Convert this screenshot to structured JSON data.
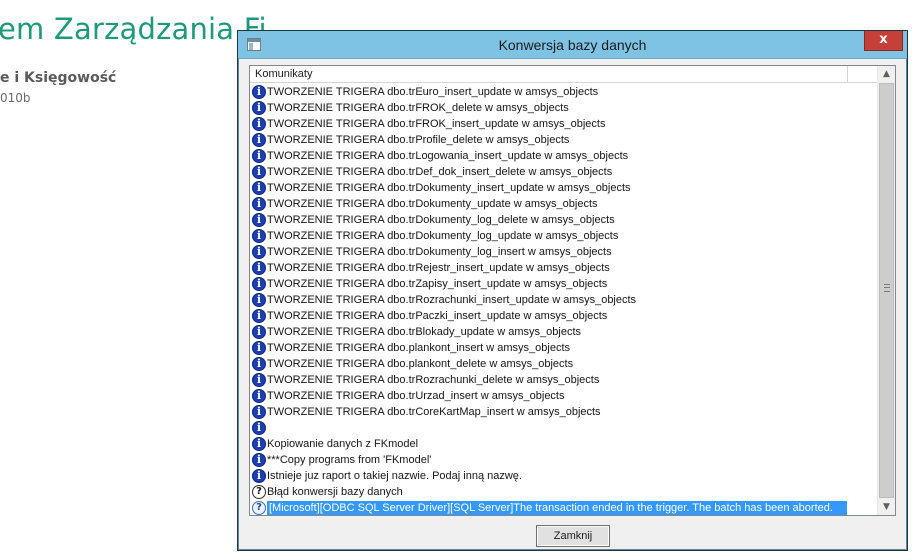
{
  "background": {
    "title": "em Zarządzania Fi",
    "subtitle": "e i Księgowość",
    "version": "010b",
    "accent_color": "#1e9a7a"
  },
  "dialog": {
    "title": "Konwersja bazy danych",
    "close_label": "x",
    "column_header": "Komunikaty",
    "close_button_label": "Zamknij",
    "messages": [
      {
        "icon": "info-icon",
        "text": "TWORZENIE TRIGERA dbo.trEuro_insert_update w amsys_objects"
      },
      {
        "icon": "info-icon",
        "text": "TWORZENIE TRIGERA dbo.trFROK_delete w amsys_objects"
      },
      {
        "icon": "info-icon",
        "text": "TWORZENIE TRIGERA dbo.trFROK_insert_update w amsys_objects"
      },
      {
        "icon": "info-icon",
        "text": "TWORZENIE TRIGERA dbo.trProfile_delete w amsys_objects"
      },
      {
        "icon": "info-icon",
        "text": "TWORZENIE TRIGERA dbo.trLogowania_insert_update w amsys_objects"
      },
      {
        "icon": "info-icon",
        "text": "TWORZENIE TRIGERA dbo.trDef_dok_insert_delete w amsys_objects"
      },
      {
        "icon": "info-icon",
        "text": "TWORZENIE TRIGERA dbo.trDokumenty_insert_update w amsys_objects"
      },
      {
        "icon": "info-icon",
        "text": "TWORZENIE TRIGERA dbo.trDokumenty_update w amsys_objects"
      },
      {
        "icon": "info-icon",
        "text": "TWORZENIE TRIGERA dbo.trDokumenty_log_delete w amsys_objects"
      },
      {
        "icon": "info-icon",
        "text": "TWORZENIE TRIGERA dbo.trDokumenty_log_update w amsys_objects"
      },
      {
        "icon": "info-icon",
        "text": "TWORZENIE TRIGERA dbo.trDokumenty_log_insert w amsys_objects"
      },
      {
        "icon": "info-icon",
        "text": "TWORZENIE TRIGERA dbo.trRejestr_insert_update w amsys_objects"
      },
      {
        "icon": "info-icon",
        "text": "TWORZENIE TRIGERA dbo.trZapisy_insert_update w amsys_objects"
      },
      {
        "icon": "info-icon",
        "text": "TWORZENIE TRIGERA dbo.trRozrachunki_insert_update w amsys_objects"
      },
      {
        "icon": "info-icon",
        "text": "TWORZENIE TRIGERA dbo.trPaczki_insert_update w amsys_objects"
      },
      {
        "icon": "info-icon",
        "text": "TWORZENIE TRIGERA dbo.trBlokady_update w amsys_objects"
      },
      {
        "icon": "info-icon",
        "text": "TWORZENIE TRIGERA dbo.plankont_insert w amsys_objects"
      },
      {
        "icon": "info-icon",
        "text": "TWORZENIE TRIGERA dbo.plankont_delete w amsys_objects"
      },
      {
        "icon": "info-icon",
        "text": "TWORZENIE TRIGERA dbo.trRozrachunki_delete w amsys_objects"
      },
      {
        "icon": "info-icon",
        "text": "TWORZENIE TRIGERA dbo.trUrzad_insert w amsys_objects"
      },
      {
        "icon": "info-icon",
        "text": "TWORZENIE TRIGERA dbo.trCoreKartMap_insert w amsys_objects"
      },
      {
        "icon": "info-icon",
        "text": ""
      },
      {
        "icon": "info-icon",
        "text": "Kopiowanie danych z FKmodel"
      },
      {
        "icon": "info-icon",
        "text": "***Copy programs from 'FKmodel'"
      },
      {
        "icon": "info-icon",
        "text": "Istnieje juz raport o takiej nazwie. Podaj inną nazwę."
      },
      {
        "icon": "question-icon",
        "text": "Błąd konwersji bazy danych"
      },
      {
        "icon": "question-icon",
        "text": "[Microsoft][ODBC SQL Server Driver][SQL Server]The transaction ended in the trigger. The batch has been aborted.",
        "selected": true
      }
    ]
  },
  "colors": {
    "titlebar": "#7fc3e4",
    "close": "#c6403a",
    "selection": "#3399ff",
    "info_icon": "#1d3faf"
  }
}
